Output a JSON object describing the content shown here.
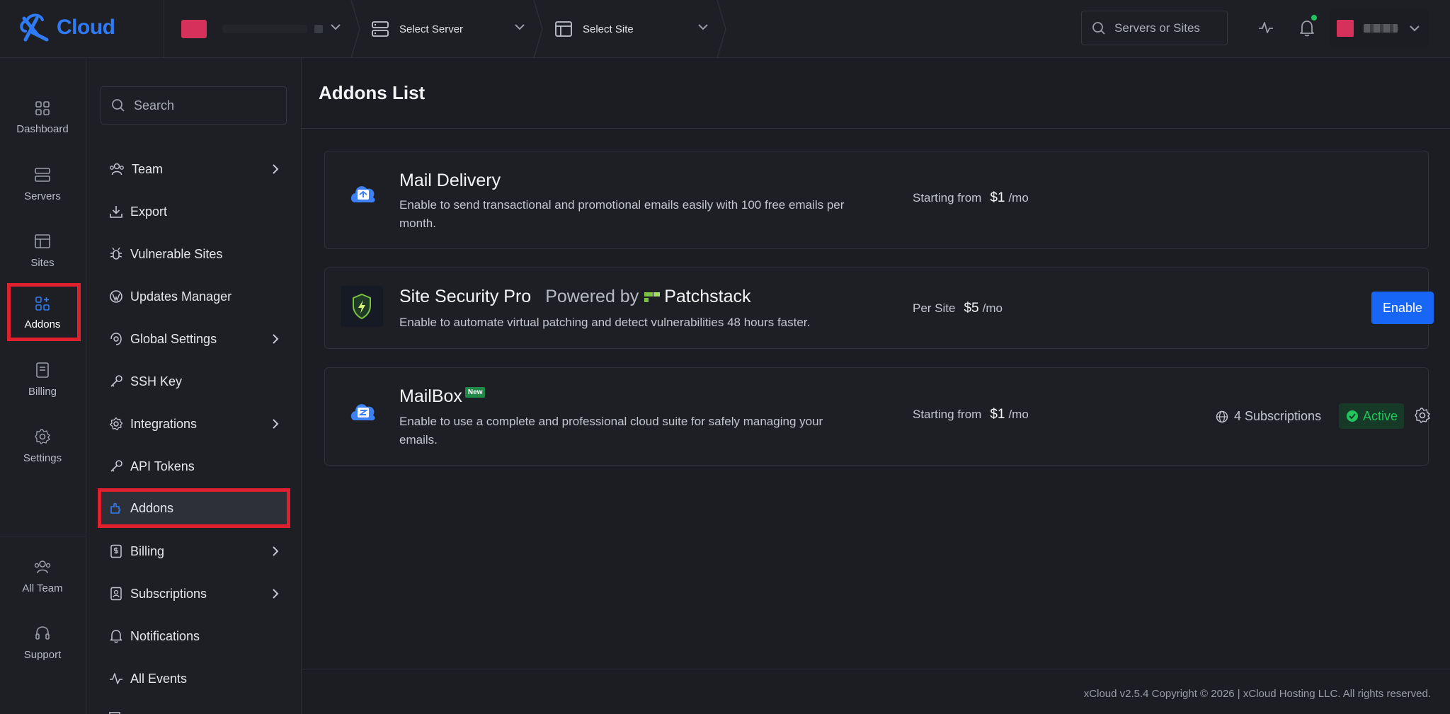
{
  "colors": {
    "accent": "#1766f5",
    "brand_blue": "#2f7bf5",
    "highlight_red": "#e0202f",
    "team_swatch": "#d6315b",
    "status_active": "#22c55e",
    "patchstack_green": "#7ac142"
  },
  "topbar": {
    "logo_text": "Cloud",
    "server_select_label": "Select Server",
    "site_select_label": "Select Site",
    "search_placeholder": "Servers or Sites"
  },
  "rail": {
    "items": [
      {
        "label": "Dashboard",
        "icon": "dashboard-icon"
      },
      {
        "label": "Servers",
        "icon": "server-icon"
      },
      {
        "label": "Sites",
        "icon": "sites-icon"
      },
      {
        "label": "Addons",
        "icon": "addons-icon",
        "active": true
      },
      {
        "label": "Billing",
        "icon": "billing-icon"
      },
      {
        "label": "Settings",
        "icon": "settings-icon"
      }
    ],
    "bottom_items": [
      {
        "label": "All Team",
        "icon": "team-icon"
      },
      {
        "label": "Support",
        "icon": "headset-icon"
      }
    ]
  },
  "subnav": {
    "search_placeholder": "Search",
    "items": [
      {
        "label": "Team",
        "icon": "team-icon",
        "has_submenu": true
      },
      {
        "label": "Export",
        "icon": "download-icon"
      },
      {
        "label": "Vulnerable Sites",
        "icon": "bug-icon"
      },
      {
        "label": "Updates Manager",
        "icon": "wordpress-icon"
      },
      {
        "label": "Global Settings",
        "icon": "globe-settings-icon",
        "has_submenu": true
      },
      {
        "label": "SSH Key",
        "icon": "key-icon"
      },
      {
        "label": "Integrations",
        "icon": "gear-icon",
        "has_submenu": true
      },
      {
        "label": "API Tokens",
        "icon": "key-icon"
      },
      {
        "label": "Addons",
        "icon": "addons-icon",
        "active": true
      },
      {
        "label": "Billing",
        "icon": "billing-icon",
        "has_submenu": true
      },
      {
        "label": "Subscriptions",
        "icon": "subscriptions-icon",
        "has_submenu": true
      },
      {
        "label": "Notifications",
        "icon": "bell-icon"
      },
      {
        "label": "All Events",
        "icon": "activity-icon"
      }
    ]
  },
  "main": {
    "page_title": "Addons List",
    "addons": [
      {
        "name": "Mail Delivery",
        "description": "Enable to send transactional and promotional emails easily with 100 free emails per month.",
        "price_prefix": "Starting from",
        "price": "$1",
        "price_period": "/mo"
      },
      {
        "name": "Site Security Pro",
        "powered_by": "Powered by",
        "partner": "Patchstack",
        "description": "Enable to automate virtual patching and detect vulnerabilities 48 hours faster.",
        "price_prefix": "Per Site",
        "price": "$5",
        "price_period": "/mo",
        "action_label": "Enable"
      },
      {
        "name": "MailBox",
        "badge": "New",
        "description": "Enable to use a complete and professional cloud suite for safely managing your emails.",
        "price_prefix": "Starting from",
        "price": "$1",
        "price_period": "/mo",
        "subscriptions": "4 Subscriptions",
        "status": "Active"
      }
    ]
  },
  "footer": {
    "text": "xCloud v2.5.4 Copyright © 2026 | xCloud Hosting LLC. All rights reserved."
  }
}
